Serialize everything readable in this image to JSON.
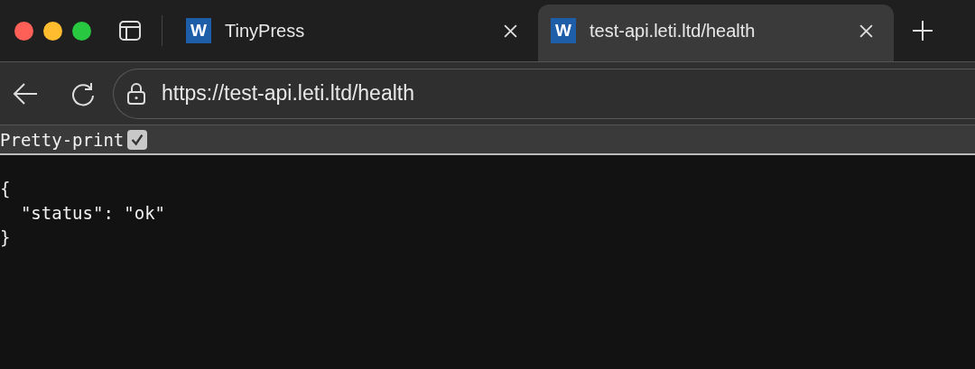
{
  "tabs": [
    {
      "favicon": "W",
      "title": "TinyPress",
      "selected": false
    },
    {
      "favicon": "W",
      "title": "test-api.leti.ltd/health",
      "selected": true
    }
  ],
  "address_bar": {
    "url": "https://test-api.leti.ltd/health"
  },
  "pretty_print": {
    "label": "Pretty-print",
    "checked": true
  },
  "body_lines": [
    "{",
    "  \"status\": \"ok\"",
    "}"
  ]
}
